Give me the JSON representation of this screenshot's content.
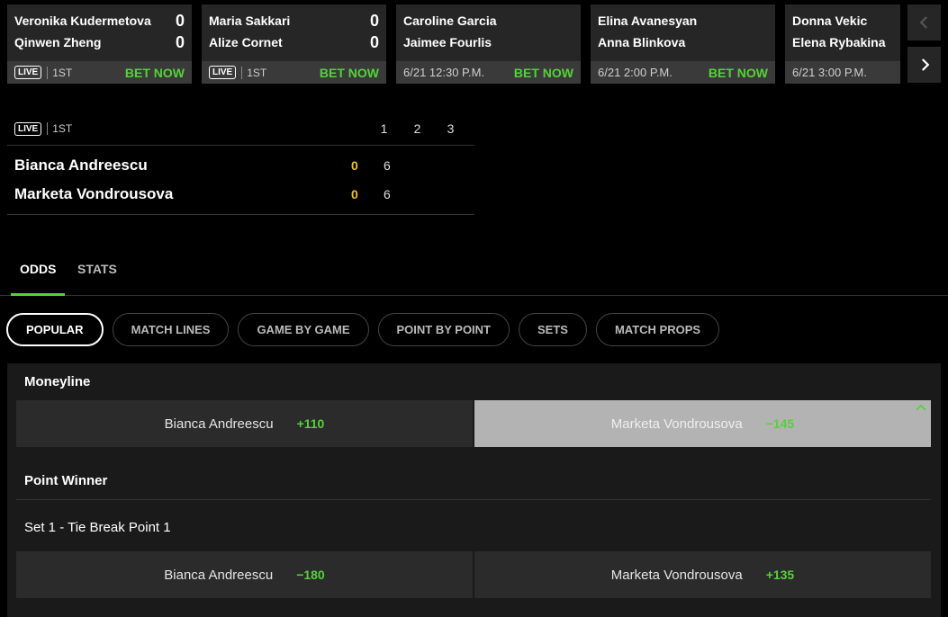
{
  "scoreboard": [
    {
      "p1": "Veronika Kudermetova",
      "p2": "Qinwen Zheng",
      "s1": "0",
      "s2": "0",
      "live": "LIVE",
      "period": "1ST",
      "bet": "BET NOW"
    },
    {
      "p1": "Maria Sakkari",
      "p2": "Alize Cornet",
      "s1": "0",
      "s2": "0",
      "live": "LIVE",
      "period": "1ST",
      "bet": "BET NOW"
    },
    {
      "p1": "Caroline Garcia",
      "p2": "Jaimee Fourlis",
      "time": "6/21 12:30 P.M.",
      "bet": "BET NOW"
    },
    {
      "p1": "Elina Avanesyan",
      "p2": "Anna Blinkova",
      "time": "6/21 2:00 P.M.",
      "bet": "BET NOW"
    },
    {
      "p1": "Donna Vekic",
      "p2": "Elena Rybakina",
      "time": "6/21 3:00 P.M."
    }
  ],
  "match": {
    "live": "LIVE",
    "period": "1ST",
    "set_heads": [
      "1",
      "2",
      "3"
    ],
    "players": [
      {
        "name": "Bianca Andreescu",
        "points": "0",
        "set1": "6"
      },
      {
        "name": "Marketa Vondrousova",
        "points": "0",
        "set1": "6"
      }
    ]
  },
  "tabs": [
    "ODDS",
    "STATS"
  ],
  "pills": [
    "POPULAR",
    "MATCH LINES",
    "GAME BY GAME",
    "POINT BY POINT",
    "SETS",
    "MATCH PROPS"
  ],
  "markets": {
    "moneyline": {
      "title": "Moneyline",
      "a_name": "Bianca Andreescu",
      "a_price": "+110",
      "b_name": "Marketa Vondrousova",
      "b_price": "−145"
    },
    "point_winner": {
      "title": "Point Winner",
      "subtitle": "Set 1 - Tie Break Point 1",
      "a_name": "Bianca Andreescu",
      "a_price": "−180",
      "b_name": "Marketa Vondrousova",
      "b_price": "+135"
    }
  },
  "colors": {
    "accent": "#53d337",
    "live_points": "#f2c40f",
    "background": "#000000"
  }
}
